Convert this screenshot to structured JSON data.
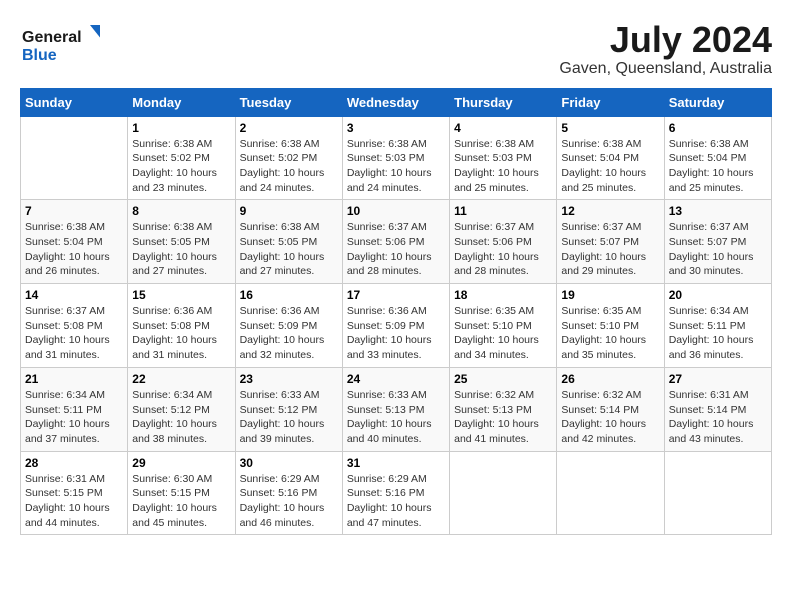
{
  "logo": {
    "line1": "General",
    "line2": "Blue"
  },
  "title": "July 2024",
  "location": "Gaven, Queensland, Australia",
  "days_of_week": [
    "Sunday",
    "Monday",
    "Tuesday",
    "Wednesday",
    "Thursday",
    "Friday",
    "Saturday"
  ],
  "weeks": [
    [
      {
        "day": "",
        "info": ""
      },
      {
        "day": "1",
        "info": "Sunrise: 6:38 AM\nSunset: 5:02 PM\nDaylight: 10 hours\nand 23 minutes."
      },
      {
        "day": "2",
        "info": "Sunrise: 6:38 AM\nSunset: 5:02 PM\nDaylight: 10 hours\nand 24 minutes."
      },
      {
        "day": "3",
        "info": "Sunrise: 6:38 AM\nSunset: 5:03 PM\nDaylight: 10 hours\nand 24 minutes."
      },
      {
        "day": "4",
        "info": "Sunrise: 6:38 AM\nSunset: 5:03 PM\nDaylight: 10 hours\nand 25 minutes."
      },
      {
        "day": "5",
        "info": "Sunrise: 6:38 AM\nSunset: 5:04 PM\nDaylight: 10 hours\nand 25 minutes."
      },
      {
        "day": "6",
        "info": "Sunrise: 6:38 AM\nSunset: 5:04 PM\nDaylight: 10 hours\nand 25 minutes."
      }
    ],
    [
      {
        "day": "7",
        "info": "Sunrise: 6:38 AM\nSunset: 5:04 PM\nDaylight: 10 hours\nand 26 minutes."
      },
      {
        "day": "8",
        "info": "Sunrise: 6:38 AM\nSunset: 5:05 PM\nDaylight: 10 hours\nand 27 minutes."
      },
      {
        "day": "9",
        "info": "Sunrise: 6:38 AM\nSunset: 5:05 PM\nDaylight: 10 hours\nand 27 minutes."
      },
      {
        "day": "10",
        "info": "Sunrise: 6:37 AM\nSunset: 5:06 PM\nDaylight: 10 hours\nand 28 minutes."
      },
      {
        "day": "11",
        "info": "Sunrise: 6:37 AM\nSunset: 5:06 PM\nDaylight: 10 hours\nand 28 minutes."
      },
      {
        "day": "12",
        "info": "Sunrise: 6:37 AM\nSunset: 5:07 PM\nDaylight: 10 hours\nand 29 minutes."
      },
      {
        "day": "13",
        "info": "Sunrise: 6:37 AM\nSunset: 5:07 PM\nDaylight: 10 hours\nand 30 minutes."
      }
    ],
    [
      {
        "day": "14",
        "info": "Sunrise: 6:37 AM\nSunset: 5:08 PM\nDaylight: 10 hours\nand 31 minutes."
      },
      {
        "day": "15",
        "info": "Sunrise: 6:36 AM\nSunset: 5:08 PM\nDaylight: 10 hours\nand 31 minutes."
      },
      {
        "day": "16",
        "info": "Sunrise: 6:36 AM\nSunset: 5:09 PM\nDaylight: 10 hours\nand 32 minutes."
      },
      {
        "day": "17",
        "info": "Sunrise: 6:36 AM\nSunset: 5:09 PM\nDaylight: 10 hours\nand 33 minutes."
      },
      {
        "day": "18",
        "info": "Sunrise: 6:35 AM\nSunset: 5:10 PM\nDaylight: 10 hours\nand 34 minutes."
      },
      {
        "day": "19",
        "info": "Sunrise: 6:35 AM\nSunset: 5:10 PM\nDaylight: 10 hours\nand 35 minutes."
      },
      {
        "day": "20",
        "info": "Sunrise: 6:34 AM\nSunset: 5:11 PM\nDaylight: 10 hours\nand 36 minutes."
      }
    ],
    [
      {
        "day": "21",
        "info": "Sunrise: 6:34 AM\nSunset: 5:11 PM\nDaylight: 10 hours\nand 37 minutes."
      },
      {
        "day": "22",
        "info": "Sunrise: 6:34 AM\nSunset: 5:12 PM\nDaylight: 10 hours\nand 38 minutes."
      },
      {
        "day": "23",
        "info": "Sunrise: 6:33 AM\nSunset: 5:12 PM\nDaylight: 10 hours\nand 39 minutes."
      },
      {
        "day": "24",
        "info": "Sunrise: 6:33 AM\nSunset: 5:13 PM\nDaylight: 10 hours\nand 40 minutes."
      },
      {
        "day": "25",
        "info": "Sunrise: 6:32 AM\nSunset: 5:13 PM\nDaylight: 10 hours\nand 41 minutes."
      },
      {
        "day": "26",
        "info": "Sunrise: 6:32 AM\nSunset: 5:14 PM\nDaylight: 10 hours\nand 42 minutes."
      },
      {
        "day": "27",
        "info": "Sunrise: 6:31 AM\nSunset: 5:14 PM\nDaylight: 10 hours\nand 43 minutes."
      }
    ],
    [
      {
        "day": "28",
        "info": "Sunrise: 6:31 AM\nSunset: 5:15 PM\nDaylight: 10 hours\nand 44 minutes."
      },
      {
        "day": "29",
        "info": "Sunrise: 6:30 AM\nSunset: 5:15 PM\nDaylight: 10 hours\nand 45 minutes."
      },
      {
        "day": "30",
        "info": "Sunrise: 6:29 AM\nSunset: 5:16 PM\nDaylight: 10 hours\nand 46 minutes."
      },
      {
        "day": "31",
        "info": "Sunrise: 6:29 AM\nSunset: 5:16 PM\nDaylight: 10 hours\nand 47 minutes."
      },
      {
        "day": "",
        "info": ""
      },
      {
        "day": "",
        "info": ""
      },
      {
        "day": "",
        "info": ""
      }
    ]
  ]
}
